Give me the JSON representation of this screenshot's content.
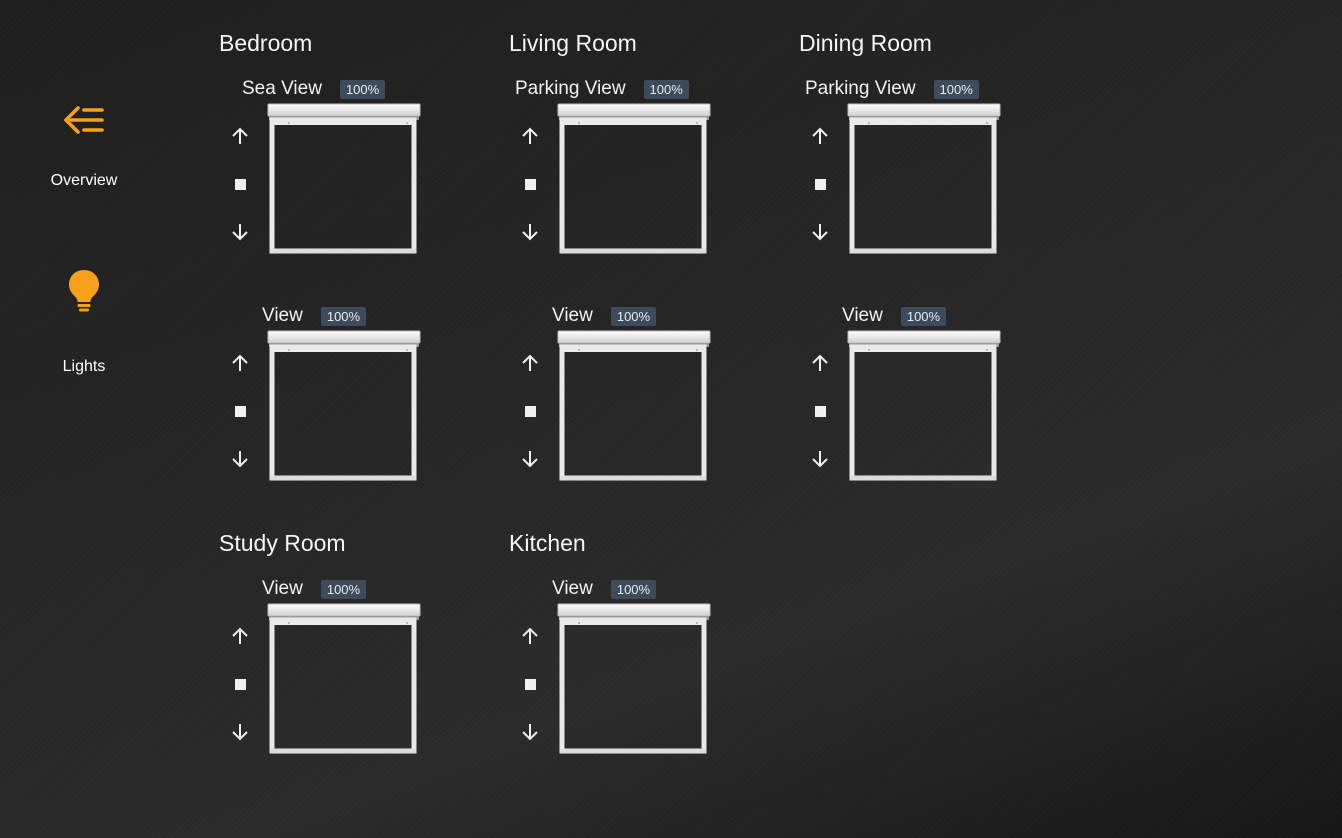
{
  "sidebar": {
    "items": [
      {
        "label": "Overview",
        "icon": "back-menu-icon"
      },
      {
        "label": "Lights",
        "icon": "lightbulb-icon"
      }
    ],
    "accent_color": "#f7a01c"
  },
  "rooms": [
    {
      "name": "Bedroom",
      "blinds": [
        {
          "name": "Sea View",
          "position": "100%"
        },
        {
          "name": "View",
          "position": "100%"
        }
      ]
    },
    {
      "name": "Living Room",
      "blinds": [
        {
          "name": "Parking View",
          "position": "100%"
        },
        {
          "name": "View",
          "position": "100%"
        }
      ]
    },
    {
      "name": "Dining Room",
      "blinds": [
        {
          "name": "Parking View",
          "position": "100%"
        },
        {
          "name": "View",
          "position": "100%"
        }
      ]
    },
    {
      "name": "Study Room",
      "blinds": [
        {
          "name": "View",
          "position": "100%"
        }
      ]
    },
    {
      "name": "Kitchen",
      "blinds": [
        {
          "name": "View",
          "position": "100%"
        }
      ]
    }
  ],
  "controls": {
    "up_icon": "arrow-up-icon",
    "stop_icon": "stop-icon",
    "down_icon": "arrow-down-icon"
  }
}
